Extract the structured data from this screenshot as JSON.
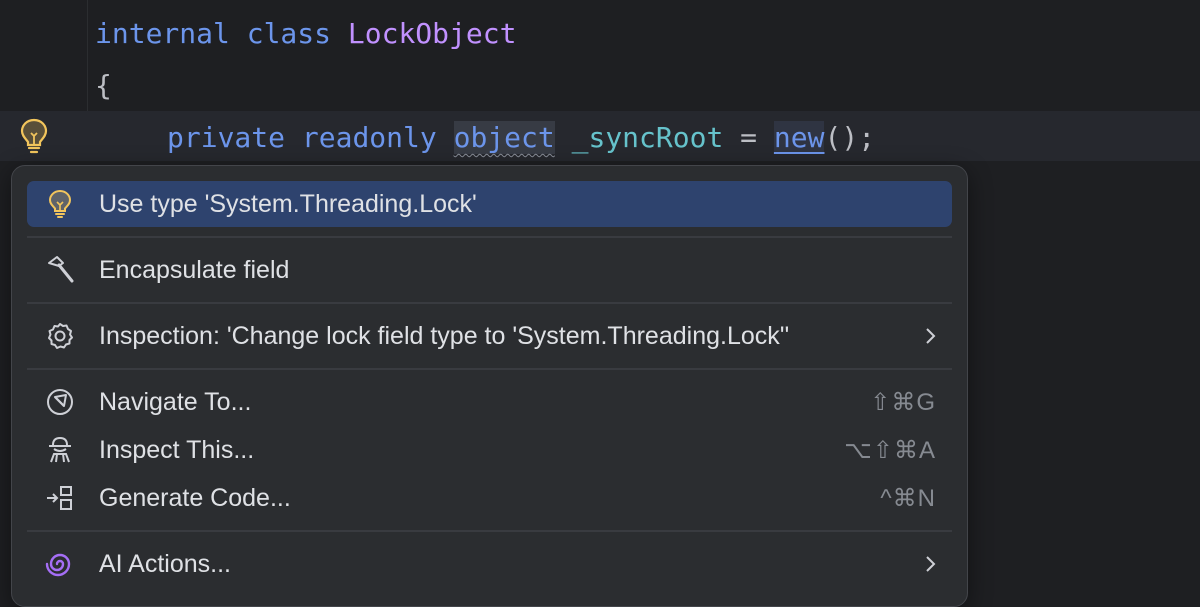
{
  "editor": {
    "line1": {
      "kw1": "internal",
      "kw2": "class",
      "name": "LockObject"
    },
    "line2": "{",
    "line3": {
      "kw1": "private",
      "kw2": "readonly",
      "type": "object",
      "field": "_syncRoot",
      "eq": " = ",
      "new_kw": "new",
      "tail": "();"
    }
  },
  "menu": {
    "items": [
      {
        "label": "Use type 'System.Threading.Lock'",
        "icon": "lightbulb-icon",
        "shortcut": ""
      },
      {
        "label": "Encapsulate field",
        "icon": "hammer-icon",
        "shortcut": ""
      },
      {
        "label": "Inspection: 'Change lock field type to 'System.Threading.Lock''",
        "icon": "gear-icon",
        "shortcut": ""
      },
      {
        "label": "Navigate To...",
        "icon": "compass-icon",
        "shortcut": "⇧⌘G"
      },
      {
        "label": "Inspect This...",
        "icon": "inspector-icon",
        "shortcut": "⌥⇧⌘A"
      },
      {
        "label": "Generate Code...",
        "icon": "generate-icon",
        "shortcut": "^⌘N"
      },
      {
        "label": "AI Actions...",
        "icon": "ai-spiral-icon",
        "shortcut": ""
      }
    ]
  },
  "colors": {
    "keyword": "#6c95eb",
    "class_name": "#c191ff",
    "field": "#66c3cc",
    "selection": "#2e436e",
    "bulb": "#f2c55c",
    "ai_accent": "#a56ef5"
  }
}
